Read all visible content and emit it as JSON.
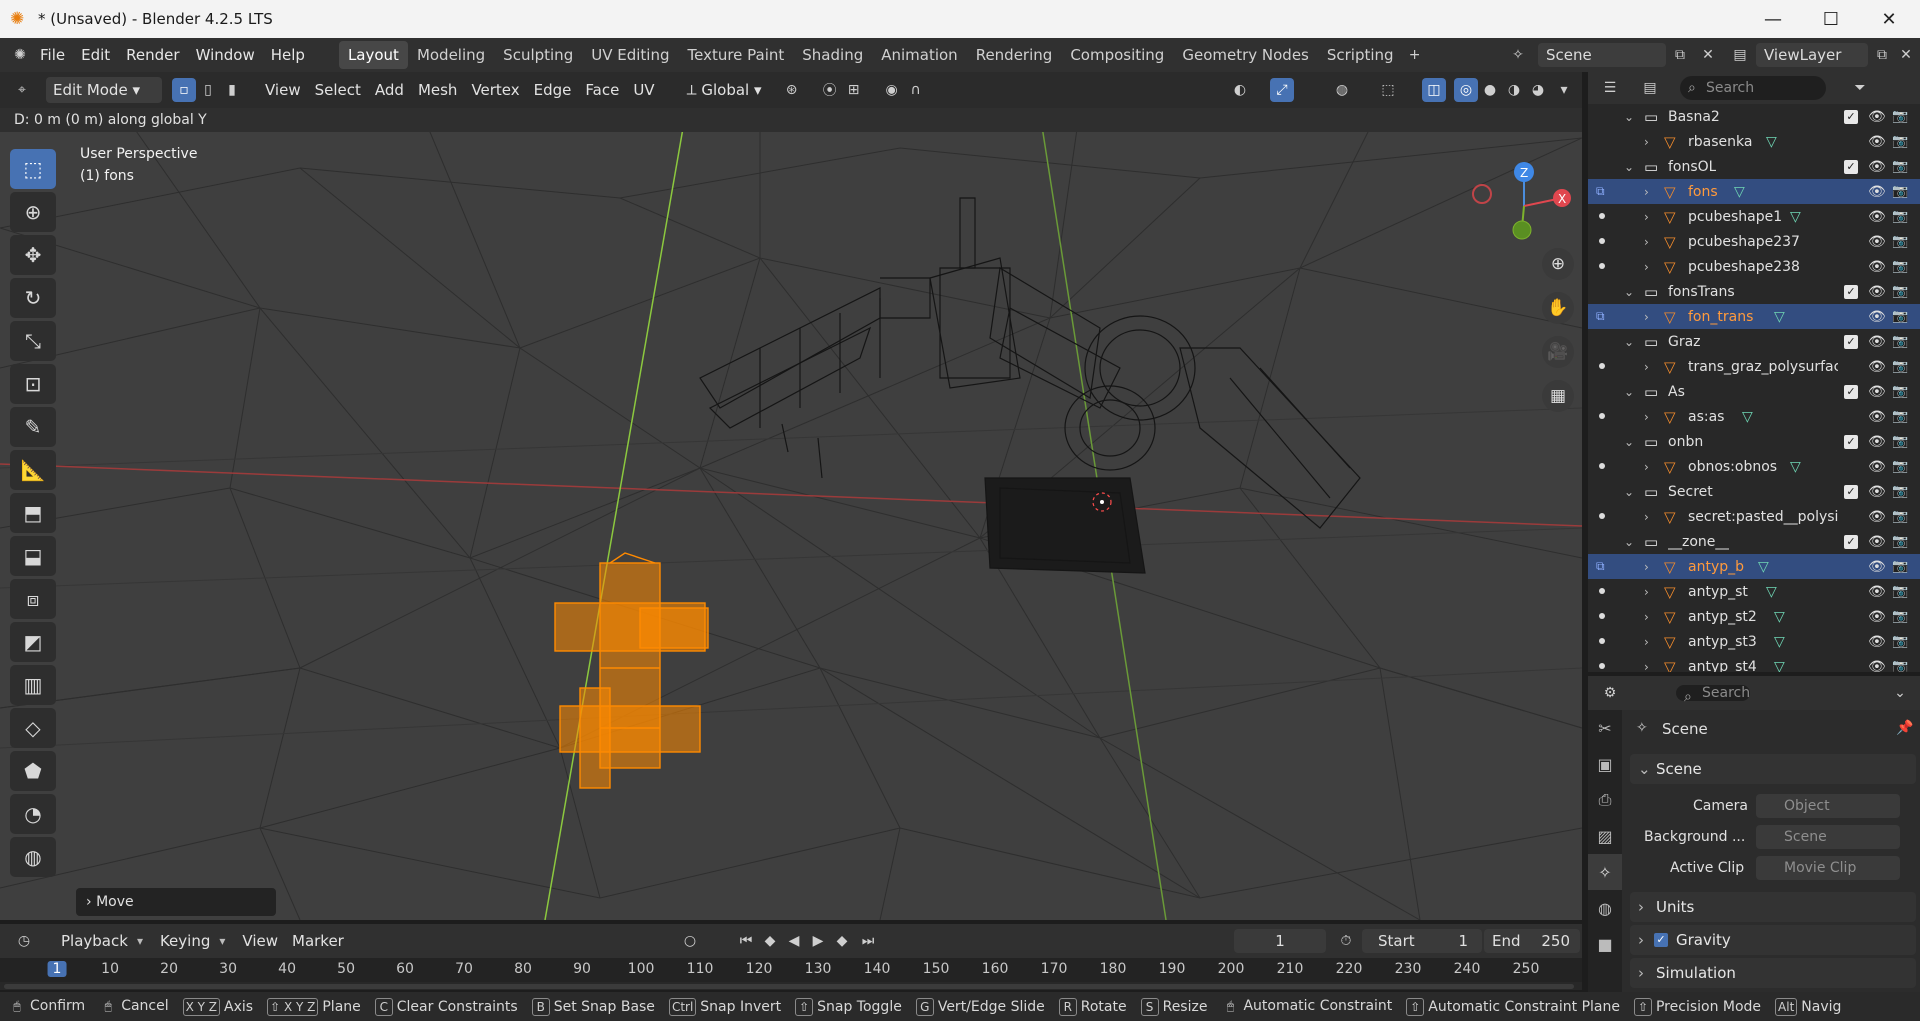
{
  "window": {
    "title": "* (Unsaved) - Blender 4.2.5 LTS"
  },
  "menus": [
    "File",
    "Edit",
    "Render",
    "Window",
    "Help"
  ],
  "workspaces": [
    "Layout",
    "Modeling",
    "Sculpting",
    "UV Editing",
    "Texture Paint",
    "Shading",
    "Animation",
    "Rendering",
    "Compositing",
    "Geometry Nodes",
    "Scripting"
  ],
  "active_workspace": "Layout",
  "scene_field": "Scene",
  "viewlayer_field": "ViewLayer",
  "header3d": {
    "mode": "Edit Mode",
    "menus": [
      "View",
      "Select",
      "Add",
      "Mesh",
      "Vertex",
      "Edge",
      "Face",
      "UV"
    ],
    "transform_orientation": "Global"
  },
  "viewport": {
    "status": "D: 0 m (0 m) along global Y",
    "view_name": "User Perspective",
    "object_name": "(1) fons",
    "last_op": "Move",
    "axis_x": "X",
    "axis_y": "Y",
    "axis_z": "Z",
    "accent_selected": "#ff8a00"
  },
  "outliner": {
    "search_placeholder": "Search",
    "rows": [
      {
        "label": "Basna2",
        "type": "collection",
        "indent": 1,
        "checked": true
      },
      {
        "label": "rbasenka",
        "type": "object",
        "indent": 2,
        "mesh": true
      },
      {
        "label": "fonsOL",
        "type": "collection",
        "indent": 1,
        "checked": true
      },
      {
        "label": "fons",
        "type": "object",
        "indent": 2,
        "mesh": true,
        "selected": true,
        "edit": true,
        "active": true
      },
      {
        "label": "pcubeshape1",
        "type": "object",
        "indent": 2,
        "mesh": true,
        "dot": true
      },
      {
        "label": "pcubeshape237",
        "type": "object",
        "indent": 2,
        "mesh": false,
        "dot": true
      },
      {
        "label": "pcubeshape238",
        "type": "object",
        "indent": 2,
        "mesh": false,
        "dot": true
      },
      {
        "label": "fonsTrans",
        "type": "collection",
        "indent": 1,
        "checked": true
      },
      {
        "label": "fon_trans",
        "type": "object",
        "indent": 2,
        "mesh": true,
        "selected": true,
        "edit": true,
        "active": true
      },
      {
        "label": "Graz",
        "type": "collection",
        "indent": 1,
        "checked": true
      },
      {
        "label": "trans_graz_polysurfac",
        "type": "object",
        "indent": 2,
        "mesh": false,
        "dot": true
      },
      {
        "label": "As",
        "type": "collection",
        "indent": 1,
        "checked": true
      },
      {
        "label": "as:as",
        "type": "object",
        "indent": 2,
        "mesh": true,
        "dot": true
      },
      {
        "label": "onbn",
        "type": "collection",
        "indent": 1,
        "checked": true
      },
      {
        "label": "obnos:obnos",
        "type": "object",
        "indent": 2,
        "mesh": true,
        "dot": true
      },
      {
        "label": "Secret",
        "type": "collection",
        "indent": 1,
        "checked": true
      },
      {
        "label": "secret:pasted__polysi",
        "type": "object",
        "indent": 2,
        "mesh": false,
        "dot": true
      },
      {
        "label": "__zone__",
        "type": "collection",
        "indent": 1,
        "checked": true
      },
      {
        "label": "antyp_b",
        "type": "object",
        "indent": 2,
        "mesh": true,
        "selected": true,
        "edit": true,
        "active": true
      },
      {
        "label": "antyp_st",
        "type": "object",
        "indent": 2,
        "mesh": true,
        "dot": true
      },
      {
        "label": "antyp_st2",
        "type": "object",
        "indent": 2,
        "mesh": true,
        "dot": true
      },
      {
        "label": "antyp_st3",
        "type": "object",
        "indent": 2,
        "mesh": true,
        "dot": true
      },
      {
        "label": "antyp_st4",
        "type": "object",
        "indent": 2,
        "mesh": true,
        "dot": true
      }
    ]
  },
  "properties": {
    "search_placeholder": "Search",
    "context_title": "Scene",
    "panel_scene": "Scene",
    "camera_label": "Camera",
    "camera_value": "Object",
    "background_label": "Background ...",
    "background_value": "Scene",
    "clip_label": "Active Clip",
    "clip_value": "Movie Clip",
    "panel_units": "Units",
    "panel_gravity": "Gravity",
    "panel_simulation": "Simulation"
  },
  "timeline": {
    "menus": [
      "Playback",
      "Keying",
      "View",
      "Marker"
    ],
    "current_frame": "1",
    "start_label": "Start",
    "start_value": "1",
    "end_label": "End",
    "end_value": "250",
    "ticks": [
      "1",
      "10",
      "20",
      "30",
      "40",
      "50",
      "60",
      "70",
      "80",
      "90",
      "100",
      "110",
      "120",
      "130",
      "140",
      "150",
      "160",
      "170",
      "180",
      "190",
      "200",
      "210",
      "220",
      "230",
      "240",
      "250"
    ]
  },
  "statusbar": [
    {
      "key": "",
      "label": "Confirm"
    },
    {
      "key": "",
      "label": "Cancel"
    },
    {
      "key": "X Y Z",
      "label": "Axis"
    },
    {
      "key": "⇧ X Y Z",
      "label": "Plane"
    },
    {
      "key": "C",
      "label": "Clear Constraints"
    },
    {
      "key": "B",
      "label": "Set Snap Base"
    },
    {
      "key": "Ctrl",
      "label": "Snap Invert"
    },
    {
      "key": "⇧",
      "label": "Snap Toggle"
    },
    {
      "key": "G",
      "label": "Vert/Edge Slide"
    },
    {
      "key": "R",
      "label": "Rotate"
    },
    {
      "key": "S",
      "label": "Resize"
    },
    {
      "key": "",
      "label": "Automatic Constraint"
    },
    {
      "key": "⇧",
      "label": "Automatic Constraint Plane"
    },
    {
      "key": "⇧",
      "label": "Precision Mode"
    },
    {
      "key": "Alt",
      "label": "Navig"
    }
  ]
}
